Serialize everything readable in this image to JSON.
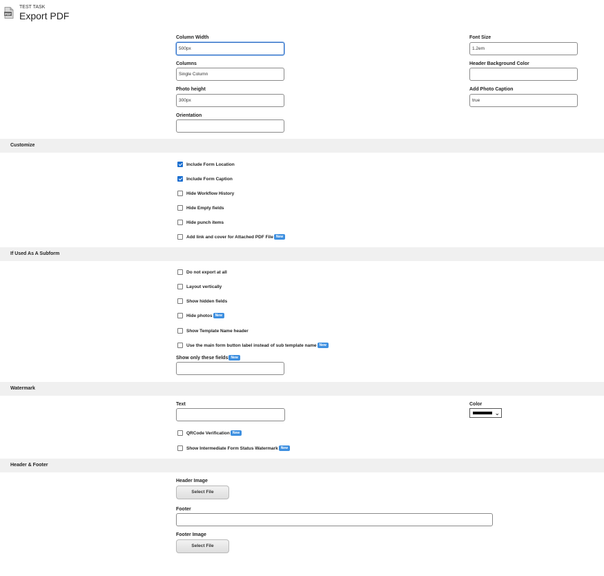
{
  "header": {
    "subtitle": "TEST TASK",
    "title": "Export PDF",
    "icon": "pdf-file-icon"
  },
  "settings": {
    "column_width": {
      "label": "Column Width",
      "value": "500px"
    },
    "columns": {
      "label": "Columns",
      "value": "Single Column"
    },
    "photo_height": {
      "label": "Photo height",
      "value": "300px"
    },
    "orientation": {
      "label": "Orientation",
      "value": ""
    },
    "font_size": {
      "label": "Font Size",
      "value": "1.2em"
    },
    "header_bg_color": {
      "label": "Header Background Color",
      "value": ""
    },
    "add_photo_caption": {
      "label": "Add Photo Caption",
      "value": "true"
    }
  },
  "customize": {
    "title": "Customize",
    "items": [
      {
        "label": "Include Form Location",
        "checked": true
      },
      {
        "label": "Include Form Caption",
        "checked": true
      },
      {
        "label": "Hide Workflow History",
        "checked": false
      },
      {
        "label": "Hide Empty fields",
        "checked": false
      },
      {
        "label": "Hide punch items",
        "checked": false
      },
      {
        "label": "Add link and cover for Attached PDF File",
        "checked": false,
        "badge": "New"
      }
    ]
  },
  "subform": {
    "title": "If Used As A Subform",
    "items": [
      {
        "label": "Do not export at all",
        "checked": false
      },
      {
        "label": "Layout vertically",
        "checked": false
      },
      {
        "label": "Show hidden fields",
        "checked": false
      },
      {
        "label": "Hide photos",
        "checked": false,
        "badge": "New"
      },
      {
        "label": "Show Template Name header",
        "checked": false
      },
      {
        "label": "Use the main form button label instead of sub template name",
        "checked": false,
        "badge": "New"
      }
    ],
    "show_only_fields": {
      "label": "Show only these fields",
      "badge": "New",
      "value": ""
    }
  },
  "watermark": {
    "title": "Watermark",
    "text": {
      "label": "Text",
      "value": ""
    },
    "color": {
      "label": "Color",
      "value": "#000000"
    },
    "items": [
      {
        "label": "QRCode Verification",
        "checked": false,
        "badge": "New"
      },
      {
        "label": "Show Intermediate Form Status Watermark",
        "checked": false,
        "badge": "New"
      }
    ]
  },
  "header_footer": {
    "title": "Header & Footer",
    "header_image": {
      "label": "Header Image",
      "button": "Select File"
    },
    "footer": {
      "label": "Footer",
      "value": ""
    },
    "footer_image": {
      "label": "Footer Image",
      "button": "Select File"
    }
  }
}
